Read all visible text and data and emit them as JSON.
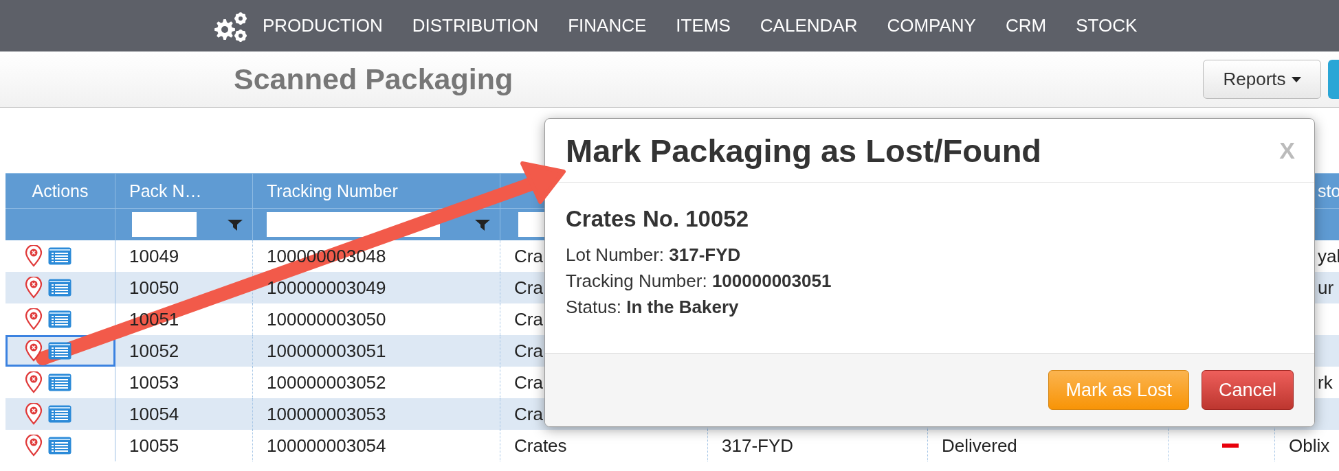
{
  "nav": {
    "items": [
      "PRODUCTION",
      "DISTRIBUTION",
      "FINANCE",
      "ITEMS",
      "CALENDAR",
      "COMPANY",
      "CRM",
      "STOCK"
    ]
  },
  "page": {
    "title": "Scanned Packaging",
    "reports_button": "Reports"
  },
  "table": {
    "columns": [
      {
        "label": "Actions",
        "filter": false
      },
      {
        "label": "Pack N…",
        "filter": true
      },
      {
        "label": "Tracking Number",
        "filter": true
      },
      {
        "label": "sto",
        "filter": false
      }
    ],
    "rows": [
      {
        "pack_number": "10049",
        "tracking_number": "100000003048",
        "column_4": "Cra",
        "column_8": "yal",
        "covered": true,
        "selected": false
      },
      {
        "pack_number": "10050",
        "tracking_number": "100000003049",
        "column_4": "Cra",
        "column_8": "ur",
        "covered": true,
        "selected": false
      },
      {
        "pack_number": "10051",
        "tracking_number": "100000003050",
        "column_4": "Cra",
        "selected": false
      },
      {
        "pack_number": "10052",
        "tracking_number": "100000003051",
        "column_4": "Cra",
        "selected": true
      },
      {
        "pack_number": "10053",
        "tracking_number": "100000003052",
        "column_4": "Cra",
        "column_8": "rk",
        "covered": true,
        "selected": false
      },
      {
        "pack_number": "10054",
        "tracking_number": "100000003053",
        "column_4": "Cra",
        "selected": false
      },
      {
        "pack_number": "10055",
        "tracking_number": "100000003054",
        "column_4": "Crates",
        "column_5": "317-FYD",
        "column_6": "Delivered",
        "marker": true,
        "column_8": "Oblix",
        "covered": false,
        "selected": false
      }
    ]
  },
  "dialog": {
    "title": "Mark Packaging as Lost/Found",
    "close": "X",
    "heading": "Crates No. 10052",
    "details": [
      {
        "label": "Lot Number:",
        "value": "317-FYD"
      },
      {
        "label": "Tracking Number:",
        "value": "100000003051"
      },
      {
        "label": "Status:",
        "value": "In the Bakery"
      }
    ],
    "buttons": [
      {
        "label": "Mark as Lost",
        "kind": "warning"
      },
      {
        "label": "Cancel",
        "kind": "danger"
      }
    ]
  }
}
